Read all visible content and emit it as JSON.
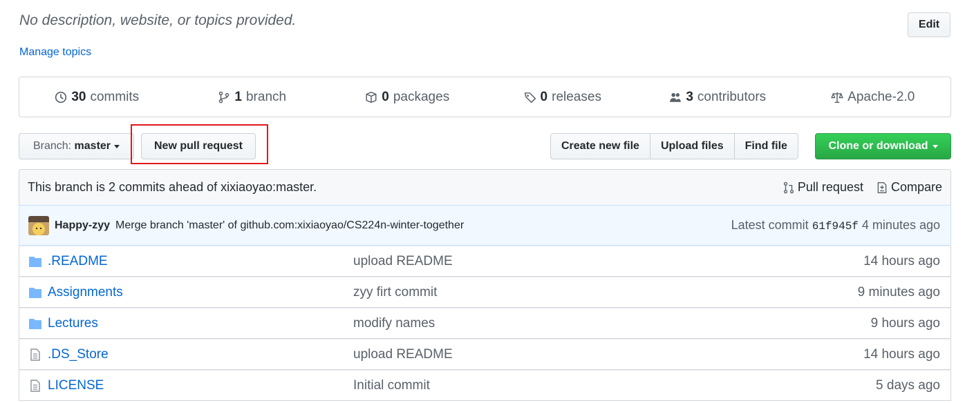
{
  "header": {
    "description": "No description, website, or topics provided.",
    "manage_topics": "Manage topics",
    "edit_label": "Edit"
  },
  "stats": [
    {
      "icon": "history-icon",
      "count": "30",
      "label": "commits"
    },
    {
      "icon": "branch-icon",
      "count": "1",
      "label": "branch"
    },
    {
      "icon": "package-icon",
      "count": "0",
      "label": "packages"
    },
    {
      "icon": "tag-icon",
      "count": "0",
      "label": "releases"
    },
    {
      "icon": "people-icon",
      "count": "3",
      "label": "contributors"
    },
    {
      "icon": "law-icon",
      "count": "",
      "label": "Apache-2.0"
    }
  ],
  "toolbar": {
    "branch_prefix": "Branch:",
    "branch_name": "master",
    "new_pull_request": "New pull request",
    "create_new_file": "Create new file",
    "upload_files": "Upload files",
    "find_file": "Find file",
    "clone_or_download": "Clone or download"
  },
  "branch_status": {
    "text": "This branch is 2 commits ahead of xixiaoyao:master.",
    "pull_request": "Pull request",
    "compare": "Compare"
  },
  "latest_commit": {
    "author": "Happy-zyy",
    "message": "Merge branch 'master' of github.com:xixiaoyao/CS224n-winter-together",
    "prefix": "Latest commit",
    "sha": "61f945f",
    "age": "4 minutes ago"
  },
  "files": [
    {
      "type": "folder",
      "name": ".README",
      "message": "upload README",
      "age": "14 hours ago"
    },
    {
      "type": "folder",
      "name": "Assignments",
      "message": "zyy firt commit",
      "age": "9 minutes ago"
    },
    {
      "type": "folder",
      "name": "Lectures",
      "message": "modify names",
      "age": "9 hours ago"
    },
    {
      "type": "file",
      "name": ".DS_Store",
      "message": "upload README",
      "age": "14 hours ago"
    },
    {
      "type": "file",
      "name": "LICENSE",
      "message": "Initial commit",
      "age": "5 days ago"
    }
  ],
  "colors": {
    "link": "#0366d6",
    "clone_green": "#28a745",
    "highlight_box": "#e0171a",
    "folder_icon": "#79b8ff"
  }
}
